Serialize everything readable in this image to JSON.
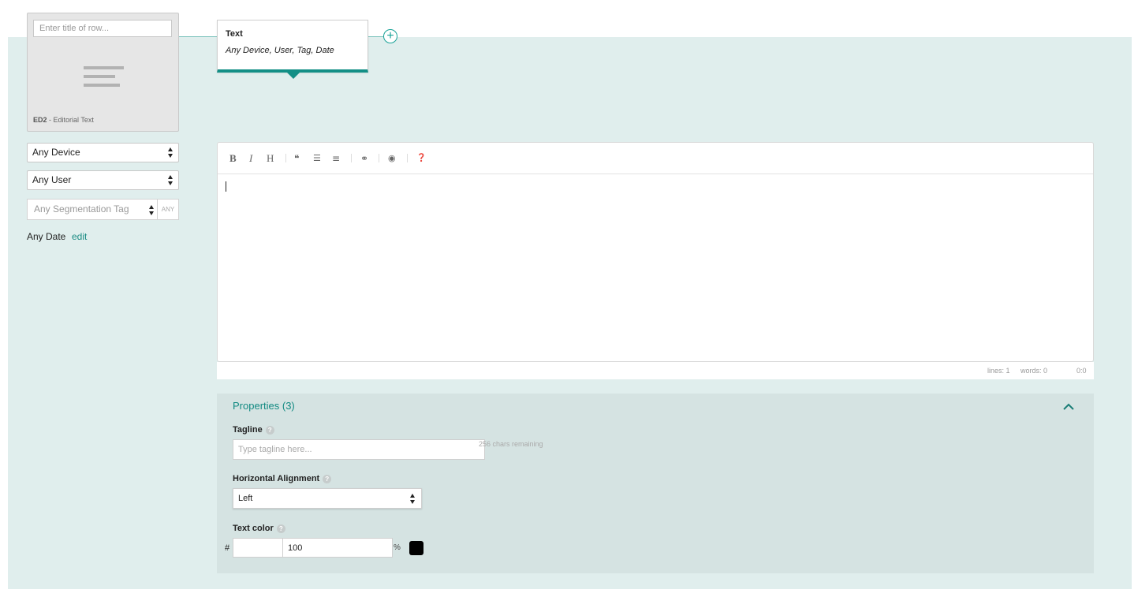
{
  "row_card": {
    "title_placeholder": "Enter title of row...",
    "icon": "paragraph-lines-icon",
    "code": "ED2",
    "type_label": " - Editorial Text"
  },
  "filters": {
    "device": "Any Device",
    "user": "Any User",
    "segmentation_placeholder": "Any Segmentation Tag",
    "segmentation_mode": "ANY",
    "date_label": "Any Date",
    "date_edit": "edit"
  },
  "popover": {
    "title": "Text",
    "subtitle": "Any Device, User, Tag, Date"
  },
  "add_row": {
    "icon": "plus-circle-icon",
    "symbol": "+"
  },
  "editor": {
    "toolbar": [
      {
        "name": "bold-icon",
        "glyph": "B"
      },
      {
        "name": "italic-icon",
        "glyph": "I"
      },
      {
        "name": "heading-icon",
        "glyph": "H"
      },
      {
        "name": "quote-icon",
        "glyph": "❝"
      },
      {
        "name": "unordered-list-icon",
        "glyph": "☰"
      },
      {
        "name": "ordered-list-icon",
        "glyph": "≡"
      },
      {
        "name": "link-icon",
        "glyph": "⚭"
      },
      {
        "name": "preview-eye-icon",
        "glyph": "◉"
      },
      {
        "name": "help-icon",
        "glyph": "❓"
      }
    ],
    "status": {
      "lines": "lines: 1",
      "words": "words: 0",
      "cursor": "0:0"
    }
  },
  "properties": {
    "title": "Properties (3)",
    "tagline": {
      "label": "Tagline",
      "placeholder": "Type tagline here...",
      "remaining": "256 chars remaining"
    },
    "alignment": {
      "label": "Horizontal Alignment",
      "value": "Left"
    },
    "text_color": {
      "label": "Text color",
      "hash": "#",
      "hex_value": "",
      "opacity": "100",
      "percent": "%",
      "swatch_color": "#000000"
    }
  },
  "colors": {
    "accent": "#138f86",
    "canvas_bg": "#e0eeed",
    "panel_bg": "#d5e3e2"
  }
}
